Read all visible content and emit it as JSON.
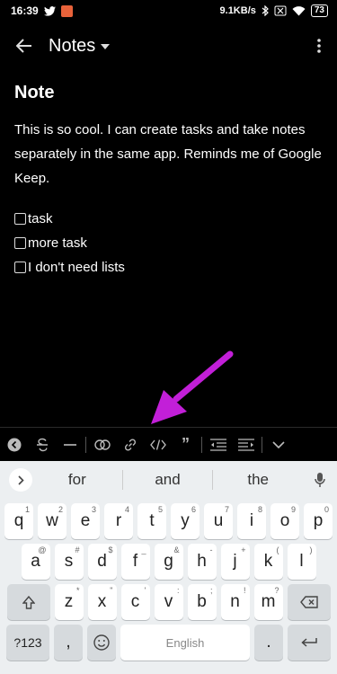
{
  "status_bar": {
    "time": "16:39",
    "net_speed": "9.1KB/s",
    "battery": "73"
  },
  "app_bar": {
    "title": "Notes"
  },
  "note": {
    "title": "Note",
    "body": "This is so cool. I can create tasks and take notes separately in the same app. Reminds me of Google Keep.",
    "tasks": [
      {
        "label": "task",
        "checked": false
      },
      {
        "label": "more task",
        "checked": false
      },
      {
        "label": "I don't need lists",
        "checked": false
      }
    ]
  },
  "format_toolbar": {
    "quote_label": "”"
  },
  "keyboard": {
    "suggestions": [
      "for",
      "and",
      "the"
    ],
    "row1": [
      {
        "key": "q",
        "hint": "1"
      },
      {
        "key": "w",
        "hint": "2"
      },
      {
        "key": "e",
        "hint": "3"
      },
      {
        "key": "r",
        "hint": "4"
      },
      {
        "key": "t",
        "hint": "5"
      },
      {
        "key": "y",
        "hint": "6"
      },
      {
        "key": "u",
        "hint": "7"
      },
      {
        "key": "i",
        "hint": "8"
      },
      {
        "key": "o",
        "hint": "9"
      },
      {
        "key": "p",
        "hint": "0"
      }
    ],
    "row2": [
      {
        "key": "a",
        "hint": "@"
      },
      {
        "key": "s",
        "hint": "#"
      },
      {
        "key": "d",
        "hint": "$"
      },
      {
        "key": "f",
        "hint": "_"
      },
      {
        "key": "g",
        "hint": "&"
      },
      {
        "key": "h",
        "hint": "-"
      },
      {
        "key": "j",
        "hint": "+"
      },
      {
        "key": "k",
        "hint": "("
      },
      {
        "key": "l",
        "hint": ")"
      }
    ],
    "row3": [
      {
        "key": "z",
        "hint": "*"
      },
      {
        "key": "x",
        "hint": "\""
      },
      {
        "key": "c",
        "hint": "'"
      },
      {
        "key": "v",
        "hint": ":"
      },
      {
        "key": "b",
        "hint": ";"
      },
      {
        "key": "n",
        "hint": "!"
      },
      {
        "key": "m",
        "hint": "?"
      }
    ],
    "symbols_label": "?123",
    "comma_label": ",",
    "space_label": "English",
    "period_label": "."
  },
  "colors": {
    "arrow": "#c21fd8",
    "background": "#000000",
    "keyboard_bg": "#eceff1"
  }
}
